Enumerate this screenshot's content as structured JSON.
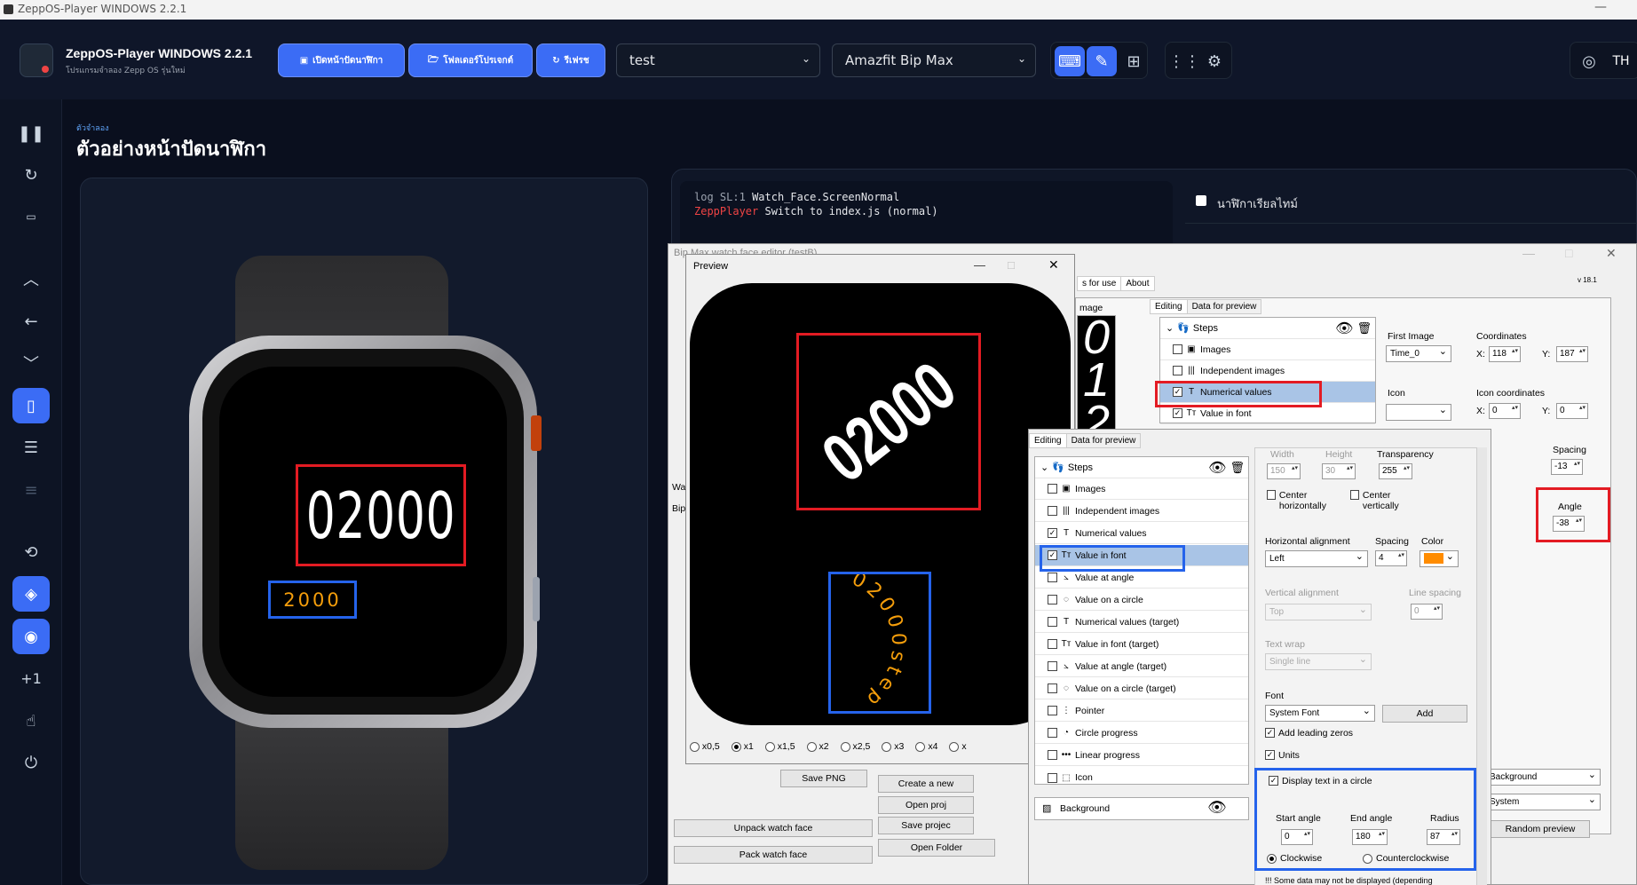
{
  "window": {
    "title": "ZeppOS-Player WINDOWS 2.2.1",
    "minimize": "—"
  },
  "header": {
    "app_title": "ZeppOS-Player WINDOWS 2.2.1",
    "app_subtitle": "โปรแกรมจำลอง Zepp OS รุ่นใหม่",
    "btn_open_watchface": "เปิดหน้าปัดนาฬิกา",
    "btn_project_folder": "โฟลเดอร์โปรเจกต์",
    "btn_refresh": "รีเฟรช",
    "project_select": "test",
    "device_select": "Amazfit Bip Max",
    "lang": "TH"
  },
  "page": {
    "breadcrumb": "ตัวจำลอง",
    "title": "ตัวอย่างหน้าปัดนาฬิกา"
  },
  "log": {
    "line1_tag": "log",
    "line1_level": "SL:1",
    "line1_msg": "Watch_Face.ScreenNormal",
    "line2_tag": "ZeppPlayer",
    "line2_msg": "Switch to  index.js  (normal)"
  },
  "right_panel": {
    "realtime_label": "นาฬิกาเรียลไทม์"
  },
  "watch": {
    "number_value": "02000",
    "font_value": "2000",
    "number_color": "#ffffff",
    "font_color": "#f59e0b"
  },
  "editor": {
    "title": "Bip Max watch face editor (testB)",
    "version": "v 18.1",
    "tab_for_use": "s for use",
    "tab_about": "About",
    "tab_editing": "Editing",
    "tab_data_preview": "Data for preview",
    "image_label": "mage",
    "steps": "Steps",
    "items_top": [
      "Images",
      "Independent images",
      "Numerical values",
      "Value in font"
    ],
    "first_image_label": "First Image",
    "first_image_value": "Time_0",
    "coordinates_label": "Coordinates",
    "coord_x": "118",
    "coord_y": "187",
    "icon_label": "Icon",
    "icon_coords_label": "Icon coordinates",
    "icon_x": "0",
    "icon_y": "0",
    "spacing_label": "Spacing",
    "spacing_value": "-13",
    "angle_label": "Angle",
    "angle_value": "-38",
    "x_label": "X:",
    "y_label": "Y:",
    "wa_label": "Wa",
    "bip_label": "Bip",
    "bg_select": "Background",
    "system_select": "System",
    "random_preview": "Random preview",
    "create_new": "Create a new",
    "open_proj": "Open proj",
    "save_proj": "Save projec",
    "open_folder": "Open Folder",
    "unpack": "Unpack watch face",
    "pack": "Pack watch face",
    "save_png": "Save PNG"
  },
  "preview": {
    "title": "Preview",
    "numbers": "02000",
    "font_text": "02000step",
    "zoom_options": [
      "x0,5",
      "x1",
      "x1,5",
      "x2",
      "x2,5",
      "x3",
      "x4",
      "x"
    ],
    "zoom_selected": "x1"
  },
  "editor2": {
    "tab_editing": "Editing",
    "tab_data_preview": "Data for preview",
    "steps": "Steps",
    "items": [
      "Images",
      "Independent images",
      "Numerical values",
      "Value in font",
      "Value at angle",
      "Value on a circle",
      "Numerical values (target)",
      "Value in font (target)",
      "Value at angle (target)",
      "Value on a circle (target)",
      "Pointer",
      "Circle progress",
      "Linear progress",
      "Icon"
    ],
    "background": "Background",
    "width_label": "Width",
    "width_value": "150",
    "height_label": "Height",
    "height_value": "30",
    "transparency_label": "Transparency",
    "transparency_value": "255",
    "center_h": "Center horizontally",
    "center_v": "Center vertically",
    "h_align_label": "Horizontal alignment",
    "h_align_value": "Left",
    "spacing_label": "Spacing",
    "spacing_value": "4",
    "color_label": "Color",
    "color_value": "#ff8c00",
    "v_align_label": "Vertical alignment",
    "v_align_value": "Top",
    "line_spacing_label": "Line spacing",
    "line_spacing_value": "0",
    "text_wrap_label": "Text wrap",
    "text_wrap_value": "Single line",
    "font_label": "Font",
    "font_value": "System Font",
    "add_btn": "Add",
    "leading_zeros": "Add leading zeros",
    "units": "Units",
    "display_circle": "Display text in a circle",
    "start_angle_label": "Start angle",
    "start_angle_value": "0",
    "end_angle_label": "End angle",
    "end_angle_value": "180",
    "radius_label": "Radius",
    "radius_value": "87",
    "clockwise": "Clockwise",
    "counterclockwise": "Counterclockwise",
    "footer_note": "!!! Some data may not be displayed (depending"
  }
}
